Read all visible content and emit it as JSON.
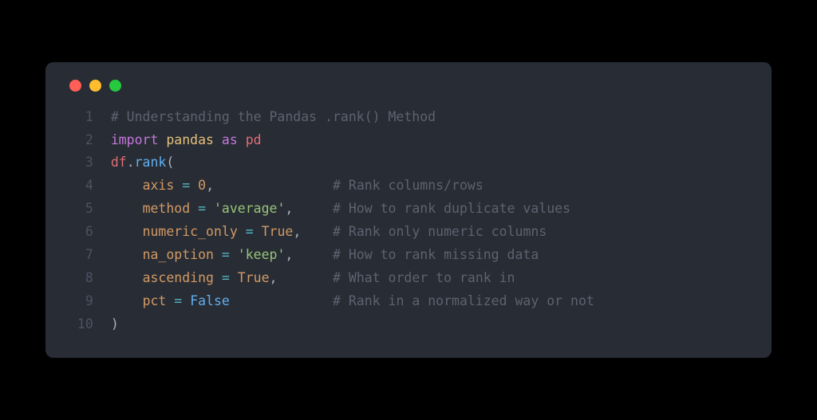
{
  "titlebar": {
    "dot_red": "close",
    "dot_yellow": "minimize",
    "dot_green": "zoom"
  },
  "gutter": "  1\n  2\n  3\n  4\n  5\n  6\n  7\n  8\n  9\n 10",
  "t": {
    "l1_comment": "# Understanding the Pandas .rank() Method",
    "l2_import": "import",
    "l2_sp1": " ",
    "l2_pandas": "pandas",
    "l2_sp2": " ",
    "l2_as": "as",
    "l2_sp3": " ",
    "l2_pd": "pd",
    "l3_df": "df",
    "l3_dot": ".",
    "l3_rank": "rank",
    "l3_open": "(",
    "indent": "    ",
    "l4_param": "axis",
    "l4_eq": " = ",
    "l4_val": "0",
    "l4_comma": ",",
    "l4_pad": "               ",
    "l4_comment": "# Rank columns/rows",
    "l5_param": "method",
    "l5_eq": " = ",
    "l5_val": "'average'",
    "l5_comma": ",",
    "l5_pad": "     ",
    "l5_comment": "# How to rank duplicate values",
    "l6_param": "numeric_only",
    "l6_eq": " = ",
    "l6_val": "True",
    "l6_comma": ",",
    "l6_pad": "    ",
    "l6_comment": "# Rank only numeric columns",
    "l7_param": "na_option",
    "l7_eq": " = ",
    "l7_val": "'keep'",
    "l7_comma": ",",
    "l7_pad": "     ",
    "l7_comment": "# How to rank missing data",
    "l8_param": "ascending",
    "l8_eq": " = ",
    "l8_val": "True",
    "l8_comma": ",",
    "l8_pad": "       ",
    "l8_comment": "# What order to rank in",
    "l9_param": "pct",
    "l9_eq": " = ",
    "l9_val": "False",
    "l9_pad": "             ",
    "l9_comment": "# Rank in a normalized way or not",
    "l10_close": ")"
  }
}
